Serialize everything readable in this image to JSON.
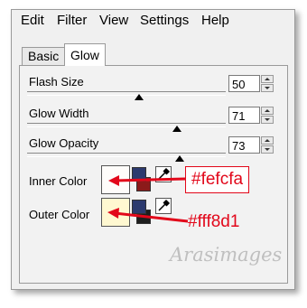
{
  "menubar": {
    "items": [
      "Edit",
      "Filter",
      "View",
      "Settings",
      "Help"
    ]
  },
  "tabs": [
    {
      "label": "Basic",
      "selected": false
    },
    {
      "label": "Glow",
      "selected": true
    }
  ],
  "controls": [
    {
      "label": "Flash Size",
      "value": "50",
      "slider_fraction": 0.5
    },
    {
      "label": "Glow Width",
      "value": "71",
      "slider_fraction": 0.72
    },
    {
      "label": "Glow Opacity",
      "value": "73",
      "slider_fraction": 0.74
    }
  ],
  "colors": {
    "inner": {
      "label": "Inner Color",
      "hex_note": "#fefcfa",
      "swatch": "#fefcfa",
      "fg": "#2c3a6e",
      "bg": "#8b1a1a"
    },
    "outer": {
      "label": "Outer Color",
      "hex_note": "#fff8d1",
      "swatch": "#fff8d1",
      "fg": "#2c3a6e",
      "bg": "#1e1e1e"
    },
    "annotation_color": "#e2071a"
  },
  "watermark": "Arasimages"
}
